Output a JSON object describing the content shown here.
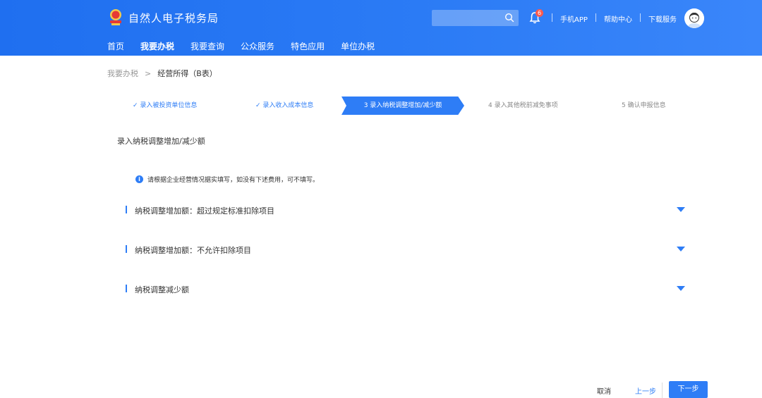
{
  "header": {
    "brand": "自然人电子税务局",
    "search_placeholder": "",
    "notification_count": "6",
    "links": [
      "手机APP",
      "帮助中心",
      "下载服务"
    ],
    "nav": [
      "首页",
      "我要办税",
      "我要查询",
      "公众服务",
      "特色应用",
      "单位办税"
    ],
    "nav_active_index": 1
  },
  "breadcrumb": {
    "parent": "我要办税",
    "separator": ">",
    "current": "经营所得（B表）"
  },
  "steps": [
    {
      "label": "✓ 录入被投资单位信息",
      "state": "done"
    },
    {
      "label": "✓ 录入收入成本信息",
      "state": "done"
    },
    {
      "label": "3 录入纳税调整增加/减少额",
      "state": "active"
    },
    {
      "label": "4 录入其他税前减免事项",
      "state": "pending"
    },
    {
      "label": "5 确认申报信息",
      "state": "pending"
    }
  ],
  "section": {
    "title": "录入纳税调整增加/减少额",
    "notice_icon": "i",
    "notice": "请根据企业经营情况据实填写，如没有下述费用，可不填写。"
  },
  "accordions": [
    {
      "label": "纳税调整增加额：超过规定标准扣除项目"
    },
    {
      "label": "纳税调整增加额：不允许扣除项目"
    },
    {
      "label": "纳税调整减少额"
    }
  ],
  "footer": {
    "cancel": "取消",
    "prev": "上一步",
    "next": "下一步"
  },
  "colors": {
    "primary": "#2e7df6",
    "header_start": "#1f6ff0",
    "header_end": "#3a86fa",
    "badge": "#ff5a4d"
  }
}
